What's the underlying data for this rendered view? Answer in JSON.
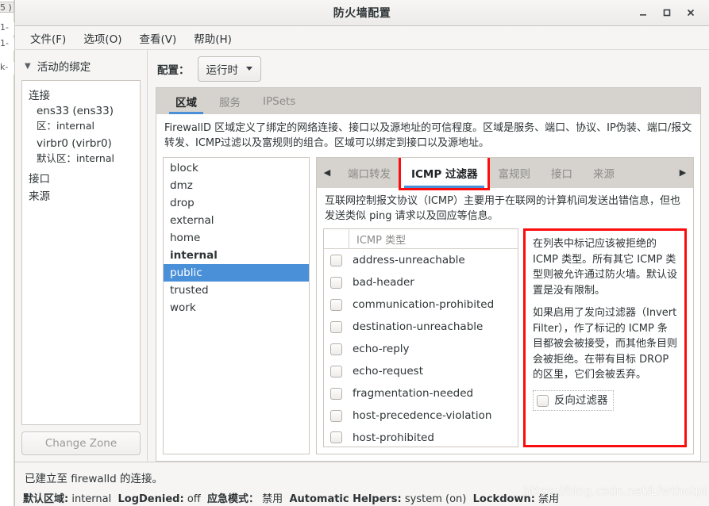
{
  "window": {
    "title": "防火墙配置",
    "buttons": {
      "minimize": "minimize-icon",
      "maximize": "maximize-icon",
      "close": "close-icon"
    }
  },
  "menubar": [
    {
      "label": "文件(F)",
      "name": "menu-file"
    },
    {
      "label": "选项(O)",
      "name": "menu-options"
    },
    {
      "label": "查看(V)",
      "name": "menu-view"
    },
    {
      "label": "帮助(H)",
      "name": "menu-help"
    }
  ],
  "background_fragments": [
    "5 )",
    "1-",
    "1-",
    "k-"
  ],
  "left_pane": {
    "bindings_header": "活动的绑定",
    "groups": [
      {
        "label": "连接"
      },
      {
        "label": "接口"
      },
      {
        "label": "来源"
      }
    ],
    "connections": [
      {
        "name": "ens33 (ens33)",
        "zone_label": "区：",
        "zone_value": "internal"
      },
      {
        "name": "virbr0 (virbr0)",
        "zone_label": "默认区：",
        "zone_value": "internal"
      }
    ],
    "change_zone_button": "Change Zone"
  },
  "config": {
    "label": "配置：",
    "selected": "运行时"
  },
  "top_tabs": [
    {
      "label": "区域",
      "active": true
    },
    {
      "label": "服务",
      "active": false
    },
    {
      "label": "IPSets",
      "active": false
    }
  ],
  "zone_description": "FirewallD 区域定义了绑定的网络连接、接口以及源地址的可信程度。区域是服务、端口、协议、IP伪装、端口/报文转发、ICMP过滤以及富规则的组合。区域可以绑定到接口以及源地址。",
  "zones": [
    {
      "name": "block",
      "state": "normal"
    },
    {
      "name": "dmz",
      "state": "normal"
    },
    {
      "name": "drop",
      "state": "normal"
    },
    {
      "name": "external",
      "state": "normal"
    },
    {
      "name": "home",
      "state": "normal"
    },
    {
      "name": "internal",
      "state": "default"
    },
    {
      "name": "public",
      "state": "selected"
    },
    {
      "name": "trusted",
      "state": "normal"
    },
    {
      "name": "work",
      "state": "normal"
    }
  ],
  "sub_tabs": {
    "prev_arrow": "left-arrow-icon",
    "next_arrow": "right-arrow-icon",
    "items": [
      {
        "label": "端口转发",
        "active": false,
        "highlighted": false
      },
      {
        "label": "ICMP 过滤器",
        "active": true,
        "highlighted": true
      },
      {
        "label": "富规则",
        "active": false,
        "highlighted": false
      },
      {
        "label": "接口",
        "active": false,
        "highlighted": false
      },
      {
        "label": "来源",
        "active": false,
        "highlighted": false
      }
    ]
  },
  "icmp": {
    "description": "互联网控制报文协议（ICMP）主要用于在联网的计算机间发送出错信息，但也发送类似 ping 请求以及回应等信息。",
    "table_header": "ICMP 类型",
    "types": [
      {
        "name": "address-unreachable",
        "checked": false
      },
      {
        "name": "bad-header",
        "checked": false
      },
      {
        "name": "communication-prohibited",
        "checked": false
      },
      {
        "name": "destination-unreachable",
        "checked": false
      },
      {
        "name": "echo-reply",
        "checked": false
      },
      {
        "name": "echo-request",
        "checked": false
      },
      {
        "name": "fragmentation-needed",
        "checked": false
      },
      {
        "name": "host-precedence-violation",
        "checked": false
      },
      {
        "name": "host-prohibited",
        "checked": false
      }
    ],
    "info_paragraph_1": "在列表中标记应该被拒绝的 ICMP 类型。所有其它 ICMP 类型则被允许通过防火墙。默认设置是没有限制。",
    "info_paragraph_2": "如果启用了发向过滤器（Invert Filter），作了标记的 ICMP 条目都被会被接受，而其他条目则会被拒绝。在带有目标 DROP 的区里，它们会被丢弃。",
    "invert_filter_label": "反向过滤器",
    "invert_filter_checked": false
  },
  "status": {
    "line1": "已建立至 firewalld 的连接。",
    "items": [
      {
        "label": "默认区域:",
        "value": "internal"
      },
      {
        "label": "LogDenied:",
        "value": "off"
      },
      {
        "label": "应急模式：",
        "value": "禁用"
      },
      {
        "label": "Automatic Helpers:",
        "value": "system (on)"
      },
      {
        "label": "Lockdown:",
        "value": "禁用"
      }
    ],
    "watermark": "https://blog.csdn.net/Lfwthotpt"
  },
  "colors": {
    "accent": "#4a90d9",
    "highlight_border": "#fb0d0d",
    "window_bg": "#f6f5f4",
    "tabstrip_bg": "#d6d2cd"
  }
}
